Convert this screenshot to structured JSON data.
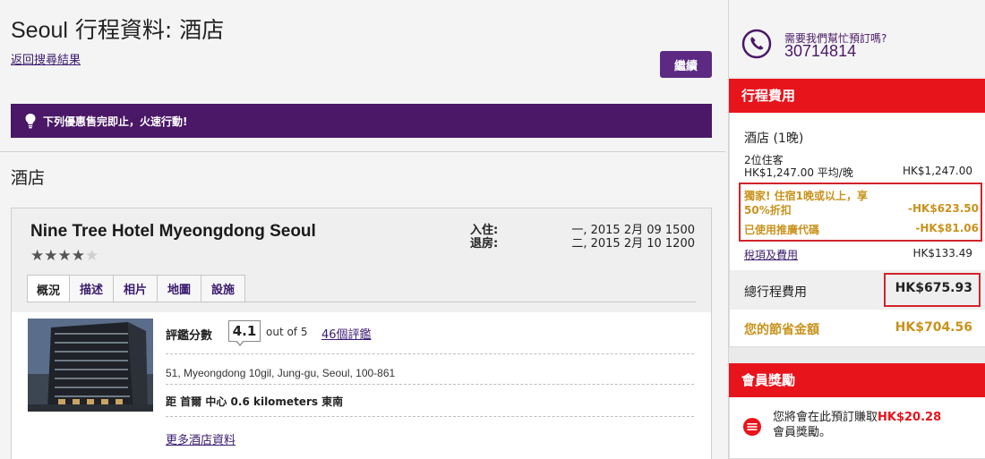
{
  "header": {
    "title_city": "Seoul",
    "title_rest": " 行程資料: 酒店",
    "back_link": "返回搜尋結果",
    "continue_button": "繼續"
  },
  "alert": {
    "icon": "lightbulb-icon",
    "text": "下列優惠售完即止，火速行動!"
  },
  "section": {
    "title": "酒店"
  },
  "hotel": {
    "name": "Nine Tree Hotel Myeongdong Seoul",
    "stars_filled": "★★★★",
    "stars_empty": "★",
    "checkin_label": "入住:",
    "checkin_value": "一, 2015 2月 09 1500",
    "checkout_label": "退房:",
    "checkout_value": "二, 2015 2月 10 1200",
    "tabs": [
      "概況",
      "描述",
      "相片",
      "地圖",
      "設施"
    ],
    "rating_label": "評鑑分數",
    "rating_value": "4.1",
    "rating_outof": "out of 5",
    "reviews_link": "46個評鑑",
    "address": "51, Myeongdong 10gil, Jung-gu, Seoul, 100-861",
    "distance": "距 首爾 中心 0.6 kilometers 東南",
    "more_info_link": "更多酒店資料"
  },
  "sidebar": {
    "help_text": "需要我們幫忙預訂嗎?",
    "help_phone": "30714814",
    "costs_header": "行程費用",
    "hotel_cost_title": "酒店 (1晚)",
    "guests": "2位住客",
    "nightly": "HK$1,247.00 平均/晚",
    "nightly_total": "HK$1,247.00",
    "promo_line1": "獨家! 住宿1晚或以上，享",
    "promo_line2": "50%折扣",
    "promo_amount1": "-HK$623.50",
    "promo_line3": "已使用推廣代碼",
    "promo_amount2": "-HK$81.06",
    "tax_link": "稅項及費用",
    "tax_amount": "HK$133.49",
    "total_label": "總行程費用",
    "total_amount": "HK$675.93",
    "save_label": "您的節省金額",
    "save_amount": "HK$704.56",
    "rewards_header": "會員獎勵",
    "rewards_text_pre": "您將會在此預訂賺取",
    "rewards_amount": "HK$20.28",
    "rewards_text_post": "會員獎勵。"
  },
  "colors": {
    "brand_purple": "#4a1866",
    "accent_red": "#e8141c",
    "gold": "#c9921c"
  }
}
